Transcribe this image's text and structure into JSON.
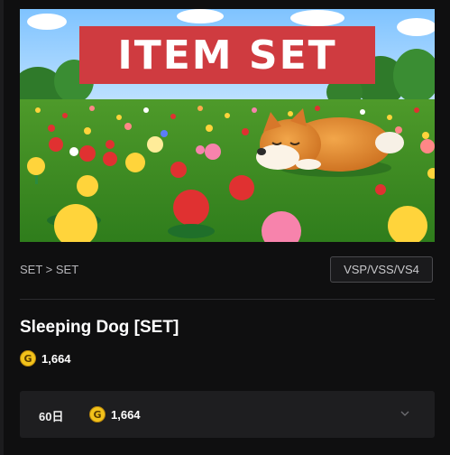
{
  "hero": {
    "banner_text": "ITEM SET"
  },
  "breadcrumb": "SET > SET",
  "compat_badge": "VSP/VSS/VS4",
  "product": {
    "title": "Sleeping Dog [SET]",
    "currency_symbol": "G",
    "price": "1,664"
  },
  "option": {
    "period": "60日",
    "currency_symbol": "G",
    "price": "1,664",
    "icon": "chevron-down-icon"
  },
  "colors": {
    "background": "#0f0f10",
    "banner_red": "#cf3b40",
    "coin_gold": "#f2c21b",
    "option_bg": "#1e1e20"
  }
}
